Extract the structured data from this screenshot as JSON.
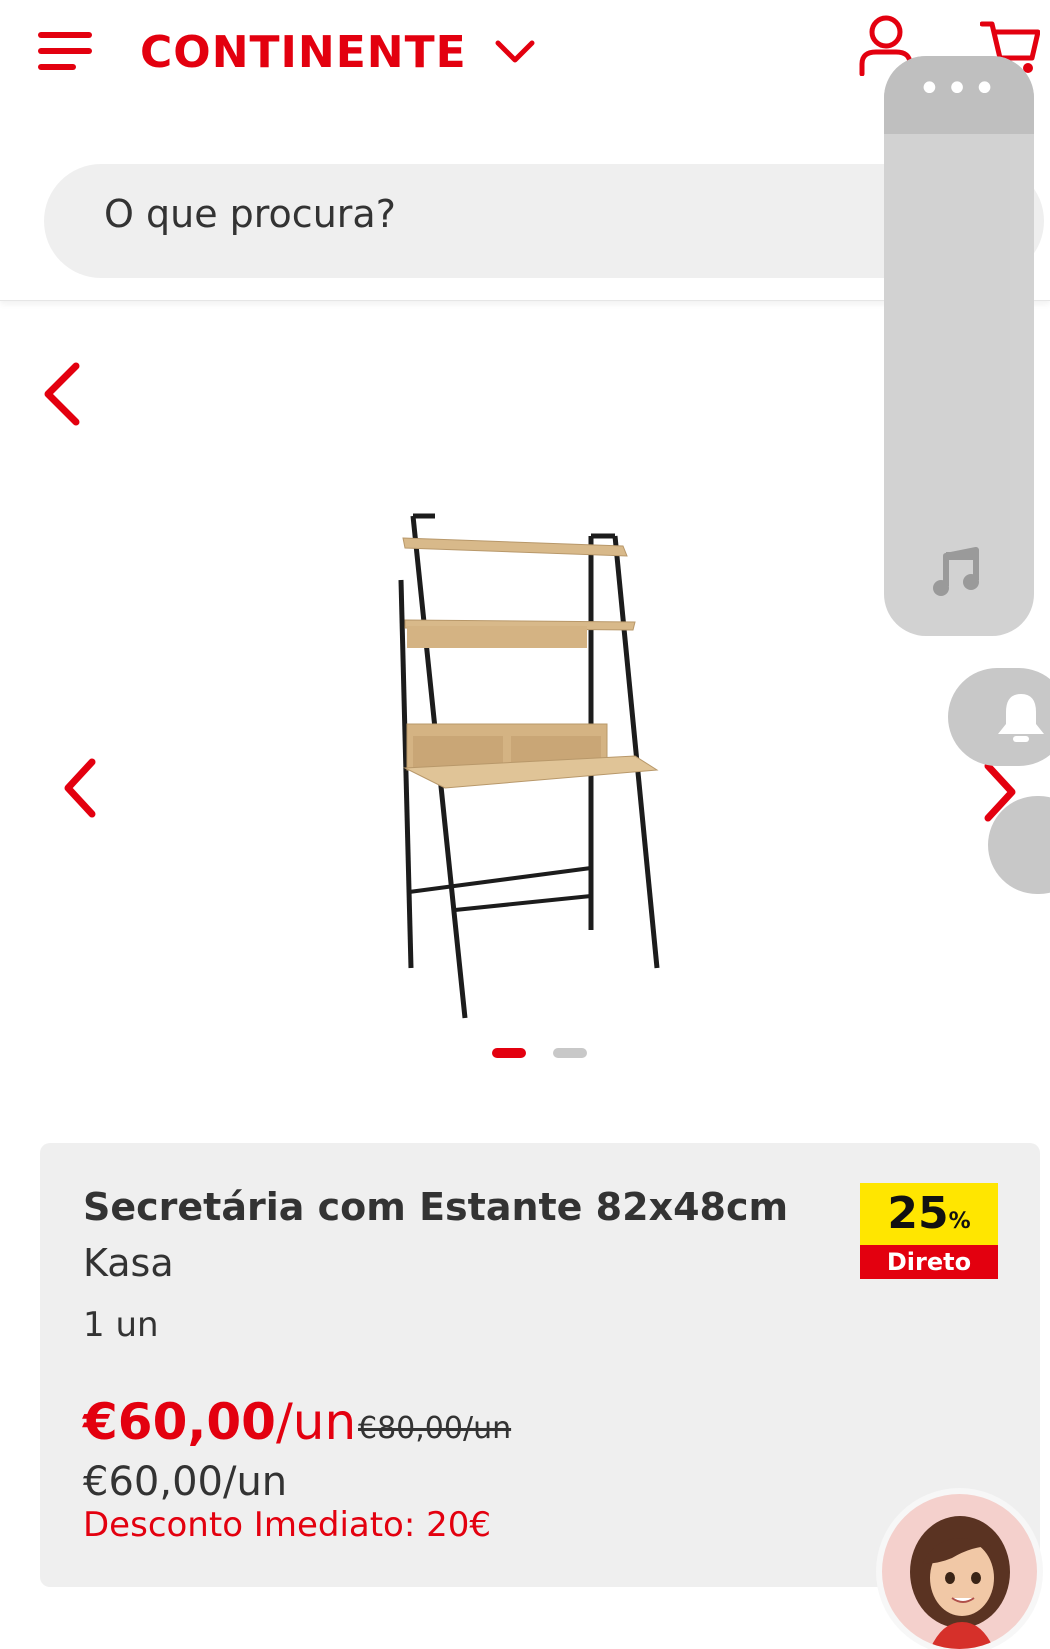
{
  "header": {
    "logo": "CONTINENTE",
    "menu_icon": "hamburger-menu-icon",
    "user_icon": "user-icon",
    "cart_icon": "cart-icon"
  },
  "search": {
    "placeholder": "O que procura?"
  },
  "gallery": {
    "image_alt": "Secretária com Estante 82x48cm",
    "total_images": 2,
    "active_index": 1
  },
  "product": {
    "title": "Secretária com Estante 82x48cm",
    "brand": "Kasa",
    "quantity": "1 un",
    "price_value": "€60,00",
    "price_unit": "/un",
    "old_price": "€80,00/un",
    "price_secondary": "€60,00/un",
    "discount_text": "Desconto Imediato: 20€",
    "badge": {
      "percent": "25",
      "percent_sign": "%",
      "label": "Direto"
    }
  },
  "colors": {
    "brand_red": "#e3000f",
    "badge_yellow": "#ffe600",
    "card_bg": "#efefef",
    "overlay_grey": "#d2d2d2"
  },
  "overlay": {
    "panel_dots": "•••"
  }
}
